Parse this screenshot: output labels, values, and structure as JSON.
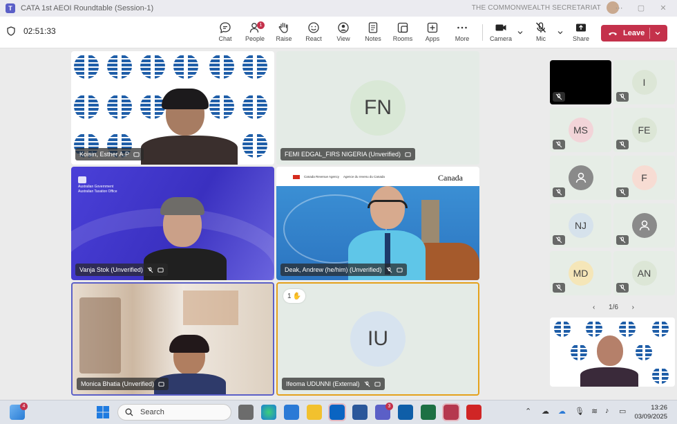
{
  "window": {
    "title": "CATA 1st AEOI Roundtable (Session-1)",
    "org": "THE COMMONWEALTH SECRETARIAT"
  },
  "toolbar": {
    "timer": "02:51:33",
    "buttons": [
      {
        "label": "Chat",
        "icon": "chat-icon"
      },
      {
        "label": "People",
        "icon": "people-icon",
        "badge": "1"
      },
      {
        "label": "Raise",
        "icon": "raise-hand-icon"
      },
      {
        "label": "React",
        "icon": "react-icon"
      },
      {
        "label": "View",
        "icon": "view-icon"
      },
      {
        "label": "Notes",
        "icon": "notes-icon"
      },
      {
        "label": "Rooms",
        "icon": "rooms-icon"
      },
      {
        "label": "Apps",
        "icon": "apps-icon"
      },
      {
        "label": "More",
        "icon": "more-icon"
      }
    ],
    "camera_label": "Camera",
    "mic_label": "Mic",
    "share_label": "Share",
    "leave_label": "Leave"
  },
  "participants": {
    "main": [
      {
        "name": "Koisin, Esther A.P"
      },
      {
        "name": "FEMI EDGAL_FIRS NIGERIA (Unverified)",
        "initials": "FN"
      },
      {
        "name": "Vanja Stok (Unverified)"
      },
      {
        "name": "Deak, Andrew (he/him) (Unverified)"
      },
      {
        "name": "Monica Bhatia (Unverified)"
      },
      {
        "name": "Ifeoma UDUNNI (External)",
        "initials": "IU",
        "reaction_count": "1"
      }
    ],
    "side": [
      {
        "initials": ""
      },
      {
        "initials": "I"
      },
      {
        "initials": "MS"
      },
      {
        "initials": "FE"
      },
      {
        "initials": ""
      },
      {
        "initials": "F"
      },
      {
        "initials": "NJ"
      },
      {
        "initials": ""
      },
      {
        "initials": "MD"
      },
      {
        "initials": "AN"
      }
    ],
    "page": "1/6"
  },
  "logos": {
    "cata": "cata",
    "canada": "Canada",
    "cra_en": "Canada Revenue Agency",
    "cra_fr": "Agence du revenu du Canada",
    "ato_line1": "Australian Government",
    "ato_line2": "Australian Taxation Office"
  },
  "taskbar": {
    "search_placeholder": "Search",
    "widgets_badge": "4",
    "teams_badge": "3",
    "time": "13:26",
    "date": "03/09/2025"
  },
  "colors": {
    "leave": "#c4314b",
    "ato_purple": "#3c34c8",
    "cata_blue": "#1f5ea8",
    "speaker_border": "#e4a11b"
  }
}
